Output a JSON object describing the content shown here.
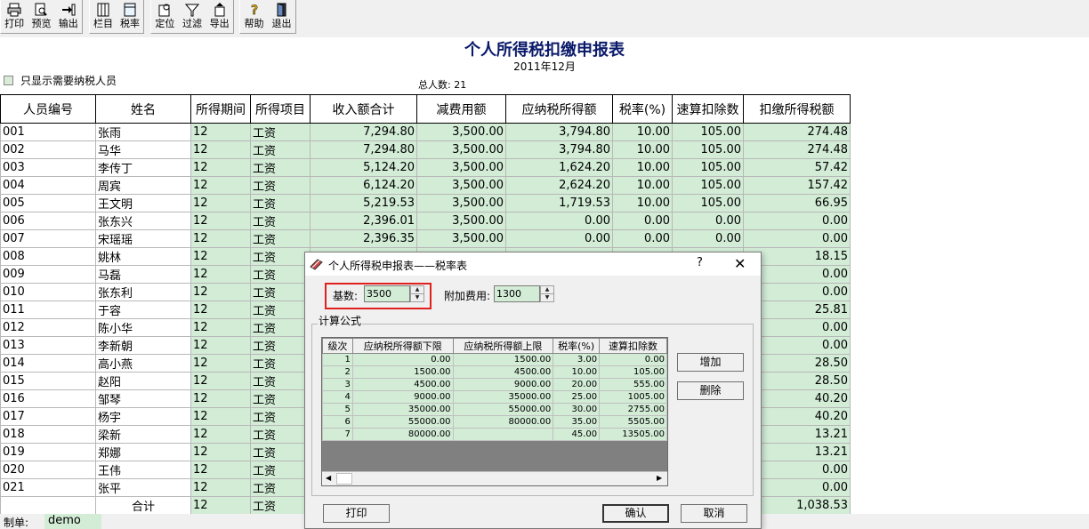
{
  "toolbar": {
    "print": "打印",
    "preview": "预览",
    "output": "输出",
    "columns": "栏目",
    "tax_rate": "税率",
    "locate": "定位",
    "filter": "过滤",
    "export": "导出",
    "help": "帮助",
    "exit": "退出"
  },
  "report": {
    "title": "个人所得税扣缴申报表",
    "period": "2011年12月",
    "show_only_taxable": "只显示需要纳税人员",
    "total_count": "总人数: 21"
  },
  "grid": {
    "headers": [
      "人员编号",
      "姓名",
      "所得期间",
      "所得项目",
      "收入额合计",
      "减费用额",
      "应纳税所得额",
      "税率(%)",
      "速算扣除数",
      "扣缴所得税额"
    ],
    "rows": [
      [
        "001",
        "张雨",
        "12",
        "工资",
        "7,294.80",
        "3,500.00",
        "3,794.80",
        "10.00",
        "105.00",
        "274.48"
      ],
      [
        "002",
        "马华",
        "12",
        "工资",
        "7,294.80",
        "3,500.00",
        "3,794.80",
        "10.00",
        "105.00",
        "274.48"
      ],
      [
        "003",
        "李传丁",
        "12",
        "工资",
        "5,124.20",
        "3,500.00",
        "1,624.20",
        "10.00",
        "105.00",
        "57.42"
      ],
      [
        "004",
        "周宾",
        "12",
        "工资",
        "6,124.20",
        "3,500.00",
        "2,624.20",
        "10.00",
        "105.00",
        "157.42"
      ],
      [
        "005",
        "王文明",
        "12",
        "工资",
        "5,219.53",
        "3,500.00",
        "1,719.53",
        "10.00",
        "105.00",
        "66.95"
      ],
      [
        "006",
        "张东兴",
        "12",
        "工资",
        "2,396.01",
        "3,500.00",
        "0.00",
        "0.00",
        "0.00",
        "0.00"
      ],
      [
        "007",
        "宋瑶瑶",
        "12",
        "工资",
        "2,396.35",
        "3,500.00",
        "0.00",
        "0.00",
        "0.00",
        "0.00"
      ],
      [
        "008",
        "姚林",
        "12",
        "工资",
        "",
        "",
        "",
        "",
        "",
        "18.15"
      ],
      [
        "009",
        "马磊",
        "12",
        "工资",
        "",
        "",
        "",
        "",
        "",
        "0.00"
      ],
      [
        "010",
        "张东利",
        "12",
        "工资",
        "",
        "",
        "",
        "",
        "",
        "0.00"
      ],
      [
        "011",
        "于容",
        "12",
        "工资",
        "",
        "",
        "",
        "",
        "",
        "25.81"
      ],
      [
        "012",
        "陈小华",
        "12",
        "工资",
        "",
        "",
        "",
        "",
        "",
        "0.00"
      ],
      [
        "013",
        "李新朝",
        "12",
        "工资",
        "",
        "",
        "",
        "",
        "",
        "0.00"
      ],
      [
        "014",
        "高小燕",
        "12",
        "工资",
        "",
        "",
        "",
        "",
        "",
        "28.50"
      ],
      [
        "015",
        "赵阳",
        "12",
        "工资",
        "",
        "",
        "",
        "",
        "",
        "28.50"
      ],
      [
        "016",
        "邹琴",
        "12",
        "工资",
        "",
        "",
        "",
        "",
        "",
        "40.20"
      ],
      [
        "017",
        "杨宇",
        "12",
        "工资",
        "",
        "",
        "",
        "",
        "",
        "40.20"
      ],
      [
        "018",
        "梁新",
        "12",
        "工资",
        "",
        "",
        "",
        "",
        "",
        "13.21"
      ],
      [
        "019",
        "郑娜",
        "12",
        "工资",
        "",
        "",
        "",
        "",
        "",
        "13.21"
      ],
      [
        "020",
        "王伟",
        "12",
        "工资",
        "",
        "",
        "",
        "",
        "",
        "0.00"
      ],
      [
        "021",
        "张平",
        "12",
        "工资",
        "",
        "",
        "",
        "",
        "",
        "0.00"
      ]
    ],
    "total_row": [
      "",
      "合计",
      "12",
      "工资",
      "",
      "",
      "",
      "",
      "",
      "1,038.53"
    ]
  },
  "footer": {
    "maker_label": "制单:",
    "maker_value": "demo"
  },
  "dialog": {
    "title": "个人所得税申报表——税率表",
    "help": "?",
    "base_label": "基数:",
    "base_value": "3500",
    "extra_label": "附加费用:",
    "extra_value": "1300",
    "group_label": "计算公式",
    "rate_headers": [
      "级次",
      "应纳税所得额下限",
      "应纳税所得额上限",
      "税率(%)",
      "速算扣除数"
    ],
    "rate_rows": [
      [
        "1",
        "0.00",
        "1500.00",
        "3.00",
        "0.00"
      ],
      [
        "2",
        "1500.00",
        "4500.00",
        "10.00",
        "105.00"
      ],
      [
        "3",
        "4500.00",
        "9000.00",
        "20.00",
        "555.00"
      ],
      [
        "4",
        "9000.00",
        "35000.00",
        "25.00",
        "1005.00"
      ],
      [
        "5",
        "35000.00",
        "55000.00",
        "30.00",
        "2755.00"
      ],
      [
        "6",
        "55000.00",
        "80000.00",
        "35.00",
        "5505.00"
      ],
      [
        "7",
        "80000.00",
        "",
        "45.00",
        "13505.00"
      ]
    ],
    "add_button": "增加",
    "delete_button": "删除",
    "print_button": "打印",
    "ok_button": "确认",
    "cancel_button": "取消"
  }
}
